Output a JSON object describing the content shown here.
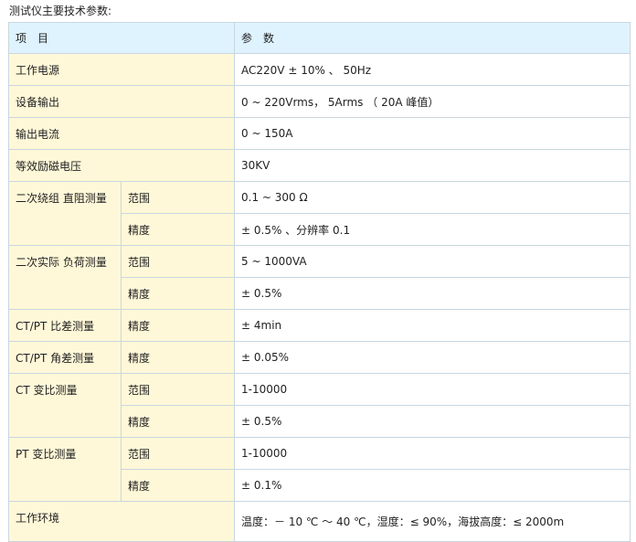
{
  "caption": "测试仪主要技术参数:",
  "header": {
    "item": "项　目",
    "param": "参　数"
  },
  "rows": {
    "power": {
      "label": "工作电源",
      "value": "AC220V ± 10% 、 50Hz"
    },
    "output": {
      "label": "设备输出",
      "value": "0 ~ 220Vrms， 5Arms （ 20A 峰值）"
    },
    "current": {
      "label": "输出电流",
      "value": "0 ~ 150A"
    },
    "excitation": {
      "label": "等效励磁电压",
      "value": "30KV"
    },
    "dc_res": {
      "label": "二次绕组 直阻测量",
      "range_label": "范围",
      "range_value": "0.1 ~ 300 Ω",
      "acc_label": "精度",
      "acc_value": "± 0.5% 、分辨率 0.1"
    },
    "load": {
      "label": "二次实际 负荷测量",
      "range_label": "范围",
      "range_value": "5 ~ 1000VA",
      "acc_label": "精度",
      "acc_value": "± 0.5%"
    },
    "ratio_err": {
      "label": "CT/PT 比差测量",
      "sub": "精度",
      "value": "± 4min"
    },
    "angle_err": {
      "label": "CT/PT 角差测量",
      "sub": "精度",
      "value": "± 0.05%"
    },
    "ct_ratio": {
      "label": "CT 变比测量",
      "range_label": "范围",
      "range_value": "1-10000",
      "acc_label": "精度",
      "acc_value": "± 0.5%"
    },
    "pt_ratio": {
      "label": "PT 变比测量",
      "range_label": "范围",
      "range_value": "1-10000",
      "acc_label": "精度",
      "acc_value": "± 0.1%"
    },
    "env": {
      "label": "工作环境",
      "value": "温度：－ 10 ℃ ～ 40 ℃，湿度：≤ 90%，海拔高度：≤ 2000m"
    }
  }
}
